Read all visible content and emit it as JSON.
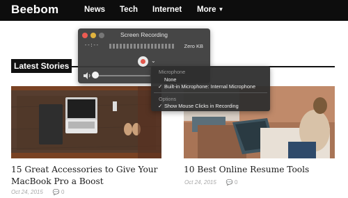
{
  "nav": {
    "logo": "Beebom",
    "items": [
      "News",
      "Tech",
      "Internet",
      "More"
    ]
  },
  "section": {
    "title": "Latest Stories"
  },
  "articles": [
    {
      "title": "15 Great Accessories to Give Your MacBook Pro a Boost",
      "date": "Oct 24, 2015",
      "comments": "0"
    },
    {
      "title": "10 Best Online Resume Tools",
      "date": "Oct 24, 2015",
      "comments": "0"
    }
  ],
  "recorder": {
    "title": "Screen Recording",
    "time": "--:--",
    "size": "Zero KB"
  },
  "menu": {
    "microphone_header": "Microphone",
    "mic_options": [
      {
        "label": "None",
        "checked": false
      },
      {
        "label": "Built-in Microphone: Internal Microphone",
        "checked": true
      }
    ],
    "options_header": "Options",
    "options": [
      {
        "label": "Show Mouse Clicks in Recording",
        "checked": true
      }
    ],
    "check_glyph": "✓"
  },
  "colors": {
    "navbar": "#0d0d0d",
    "record_red": "#e2574c"
  }
}
